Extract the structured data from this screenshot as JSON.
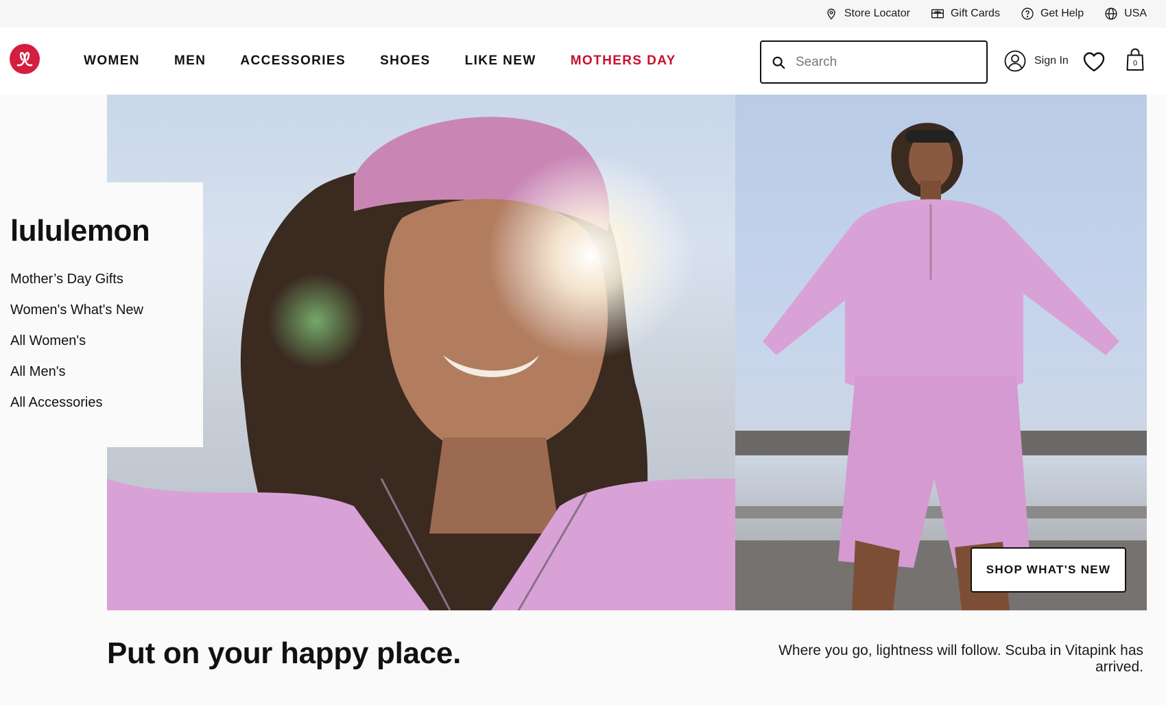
{
  "utility_bar": {
    "store_locator": "Store Locator",
    "gift_cards": "Gift Cards",
    "get_help": "Get Help",
    "region": "USA"
  },
  "header": {
    "nav": [
      {
        "label": "WOMEN"
      },
      {
        "label": "MEN"
      },
      {
        "label": "ACCESSORIES"
      },
      {
        "label": "SHOES"
      },
      {
        "label": "LIKE NEW"
      },
      {
        "label": "MOTHERS DAY"
      }
    ],
    "search_placeholder": "Search",
    "search_value": "",
    "sign_in": "Sign In",
    "bag_count": "0"
  },
  "hero": {
    "brand": "lululemon",
    "categories": [
      {
        "label": "Mother’s Day Gifts"
      },
      {
        "label": "Women's What's New"
      },
      {
        "label": "All Women's"
      },
      {
        "label": "All Men's"
      },
      {
        "label": "All Accessories"
      }
    ],
    "cta": "SHOP WHAT'S NEW",
    "headline": "Put on your happy place.",
    "subline": "Where you go, lightness will follow. Scuba in Vitapink has arrived."
  },
  "colors": {
    "brand_red": "#d31e3f",
    "accent_nav": "#c8102e",
    "hoodie_pink": "#d9a2d6"
  },
  "icons": [
    "location-pin-icon",
    "gift-card-icon",
    "help-circle-icon",
    "globe-icon",
    "lululemon-logo",
    "search-icon",
    "user-icon",
    "heart-icon",
    "bag-icon"
  ]
}
